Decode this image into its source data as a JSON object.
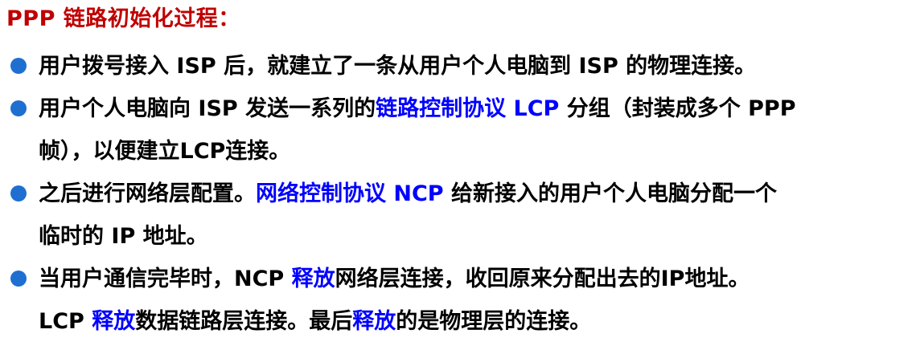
{
  "title": "PPP 链路初始化过程：",
  "accent_colors": {
    "title": "#c00000",
    "highlight": "#0000ff",
    "bullet": "#1f6fd1"
  },
  "bullets": [
    {
      "line1": {
        "t1": "用户拨号接入 ISP 后，就建立了一条从用户个人电脑到 ISP 的物理连接。"
      }
    },
    {
      "line1": {
        "t1": "用户个人电脑向 ISP 发送一系列的",
        "h1": "链路控制协议 LCP",
        "t2": " 分组（封装成多个 PPP"
      },
      "line2": {
        "t1": "帧），以便建立LCP连接。"
      }
    },
    {
      "line1": {
        "t1": "之后进行网络层配置。",
        "h1": "网络控制协议 NCP",
        "t2": " 给新接入的用户个人电脑分配一个"
      },
      "line2": {
        "t1": "临时的 IP 地址。"
      }
    },
    {
      "line1": {
        "t1": "当用户通信完毕时，NCP ",
        "h1": "释放",
        "t2": "网络层连接，收回原来分配出去的IP地址。"
      },
      "line2": {
        "t1": "LCP ",
        "h1": "释放",
        "t2": "数据链路层连接。最后",
        "h2": "释放",
        "t3": "的是物理层的连接。"
      }
    }
  ]
}
